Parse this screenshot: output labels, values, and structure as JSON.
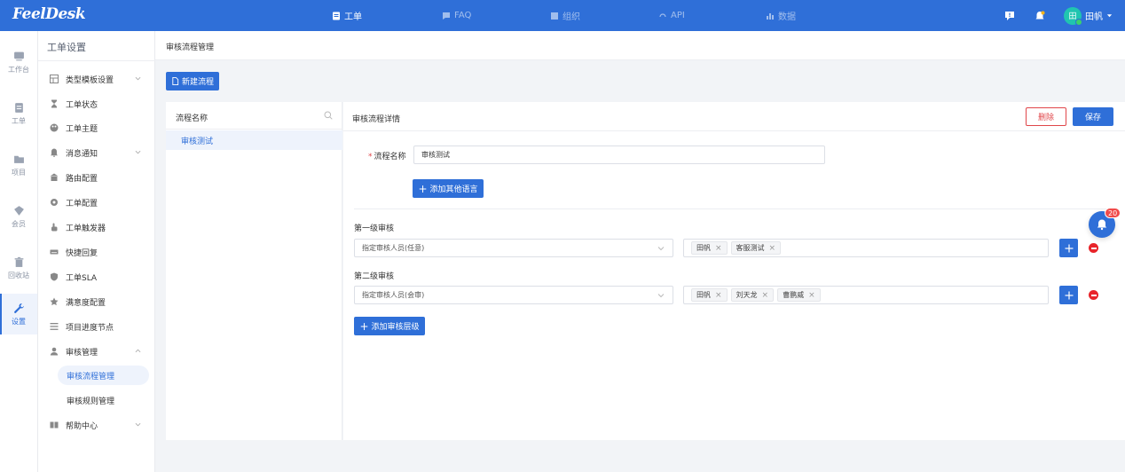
{
  "app": {
    "logo": "FeelDesk"
  },
  "topnav": [
    {
      "label": "工单",
      "icon": "ticket-icon",
      "active": true
    },
    {
      "label": "FAQ",
      "icon": "faq-icon",
      "active": false
    },
    {
      "label": "组织",
      "icon": "org-icon",
      "active": false
    },
    {
      "label": "API",
      "icon": "api-icon",
      "active": false
    },
    {
      "label": "数据",
      "icon": "chart-icon",
      "active": false
    }
  ],
  "user": {
    "avatar_text": "田",
    "name": "田帆"
  },
  "rail": [
    {
      "label": "工作台",
      "icon": "workbench-icon"
    },
    {
      "label": "工单",
      "icon": "ticket-icon"
    },
    {
      "label": "项目",
      "icon": "folder-icon"
    },
    {
      "label": "会员",
      "icon": "member-icon"
    },
    {
      "label": "回收站",
      "icon": "trash-icon"
    },
    {
      "label": "设置",
      "icon": "wrench-icon",
      "active": true
    }
  ],
  "sidebar": {
    "title": "工单设置",
    "items": [
      {
        "label": "类型模板设置",
        "icon": "template-icon",
        "chevron": "down"
      },
      {
        "label": "工单状态",
        "icon": "hourglass-icon"
      },
      {
        "label": "工单主题",
        "icon": "theme-icon"
      },
      {
        "label": "消息通知",
        "icon": "bell-icon",
        "chevron": "down"
      },
      {
        "label": "路由配置",
        "icon": "route-icon"
      },
      {
        "label": "工单配置",
        "icon": "gear-icon"
      },
      {
        "label": "工单触发器",
        "icon": "hand-icon"
      },
      {
        "label": "快捷回复",
        "icon": "keyboard-icon"
      },
      {
        "label": "工单SLA",
        "icon": "shield-icon"
      },
      {
        "label": "满意度配置",
        "icon": "star-icon"
      },
      {
        "label": "项目进度节点",
        "icon": "list-icon"
      },
      {
        "label": "审核管理",
        "icon": "user-icon",
        "chevron": "up"
      },
      {
        "label": "帮助中心",
        "icon": "book-icon",
        "chevron": "down"
      }
    ],
    "sub_items": [
      {
        "label": "审核流程管理",
        "active": true
      },
      {
        "label": "审核规则管理",
        "active": false
      }
    ]
  },
  "breadcrumb": "审核流程管理",
  "new_button": "新建流程",
  "list": {
    "header": "流程名称",
    "items": [
      "审核测试"
    ]
  },
  "detail": {
    "title": "审核流程详情",
    "delete_label": "删除",
    "save_label": "保存",
    "name_label": "流程名称",
    "required_mark": "*",
    "name_value": "审核测试",
    "add_language": "添加其他语言",
    "levels": [
      {
        "label": "第一级审核",
        "mode": "指定审核人员(任意)",
        "reviewers": [
          "田帆",
          "客服测试"
        ]
      },
      {
        "label": "第二级审核",
        "mode": "指定审核人员(会审)",
        "reviewers": [
          "田帆",
          "刘天龙",
          "曹鹏威"
        ]
      }
    ],
    "add_level": "添加审核层级"
  },
  "notifications": {
    "count": "20"
  },
  "colors": {
    "primary": "#2f6fd8",
    "danger": "#e8242a",
    "avatar": "#20c5b0"
  }
}
